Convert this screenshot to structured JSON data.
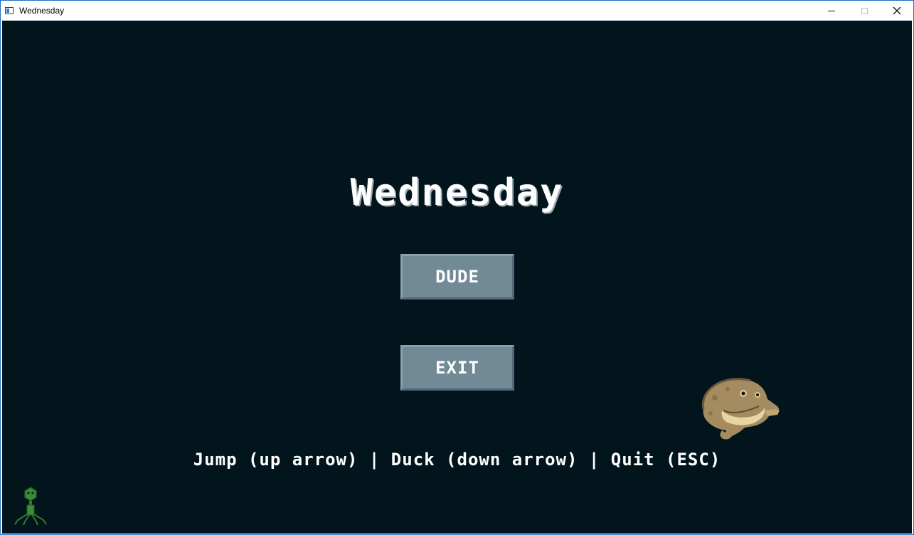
{
  "window": {
    "title": "Wednesday",
    "controls": [
      "minimize-icon",
      "maximize-icon",
      "close-icon"
    ]
  },
  "game": {
    "title": "Wednesday",
    "menu": {
      "dude_label": "DUDE",
      "exit_label": "EXIT"
    },
    "controls_text": "Jump (up arrow) | Duck (down arrow) | Quit (ESC)",
    "colors": {
      "background": "#02151c",
      "button": "#728996",
      "text": "#ffffff"
    },
    "sprites": [
      "frog-sprite",
      "virus-sprite"
    ]
  }
}
